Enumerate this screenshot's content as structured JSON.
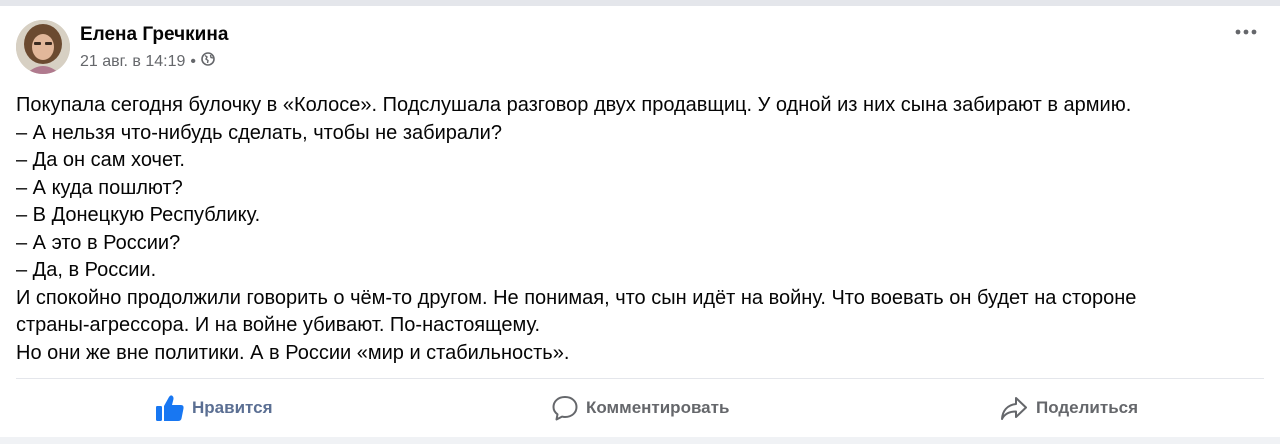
{
  "post": {
    "author_name": "Елена Гречкина",
    "timestamp": "21 авг. в 14:19",
    "separator": "•",
    "audience_icon": "globe-icon",
    "menu_icon": "more-options-icon",
    "lines": [
      "Покупала сегодня булочку в «Колосе». Подслушала разговор двух продавщиц. У одной из них сына забирают в армию.",
      "– А нельзя что-нибудь сделать, чтобы не забирали?",
      "– Да он сам хочет.",
      "– А куда пошлют?",
      "– В Донецкую Республику.",
      "– А это в России?",
      "– Да, в России.",
      "И спокойно продолжили говорить о чём-то другом. Не понимая, что сын идёт на войну. Что воевать он будет на стороне",
      "страны-агрессора. И на войне убивают. По-настоящему.",
      "Но они же вне политики. А в России «мир и стабильность»."
    ]
  },
  "actions": {
    "like_label": "Нравится",
    "comment_label": "Комментировать",
    "share_label": "Поделиться"
  },
  "colors": {
    "like_accent": "#5b6f93",
    "secondary_text": "#65676b",
    "primary_text": "#050505"
  }
}
